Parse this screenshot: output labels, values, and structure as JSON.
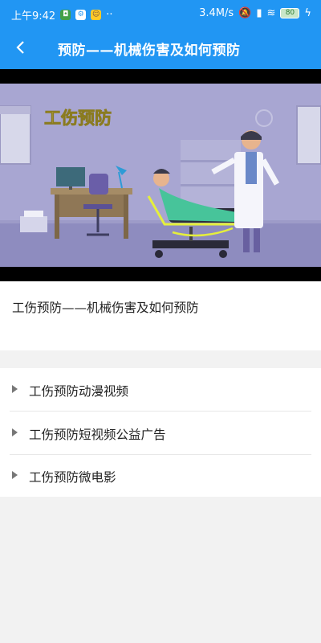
{
  "status_bar": {
    "time": "上午9:42",
    "dots": "··",
    "speed": "3.4M/s",
    "battery": "80"
  },
  "header": {
    "title": "预防——机械伤害及如何预防"
  },
  "video": {
    "overlay_text": "工伤预防"
  },
  "content": {
    "title": "工伤预防——机械伤害及如何预防"
  },
  "list": {
    "items": [
      {
        "label": "工伤预防动漫视频"
      },
      {
        "label": "工伤预防短视频公益广告"
      },
      {
        "label": "工伤预防微电影"
      }
    ]
  },
  "colors": {
    "primary": "#2196f3",
    "background": "#f2f2f2"
  }
}
